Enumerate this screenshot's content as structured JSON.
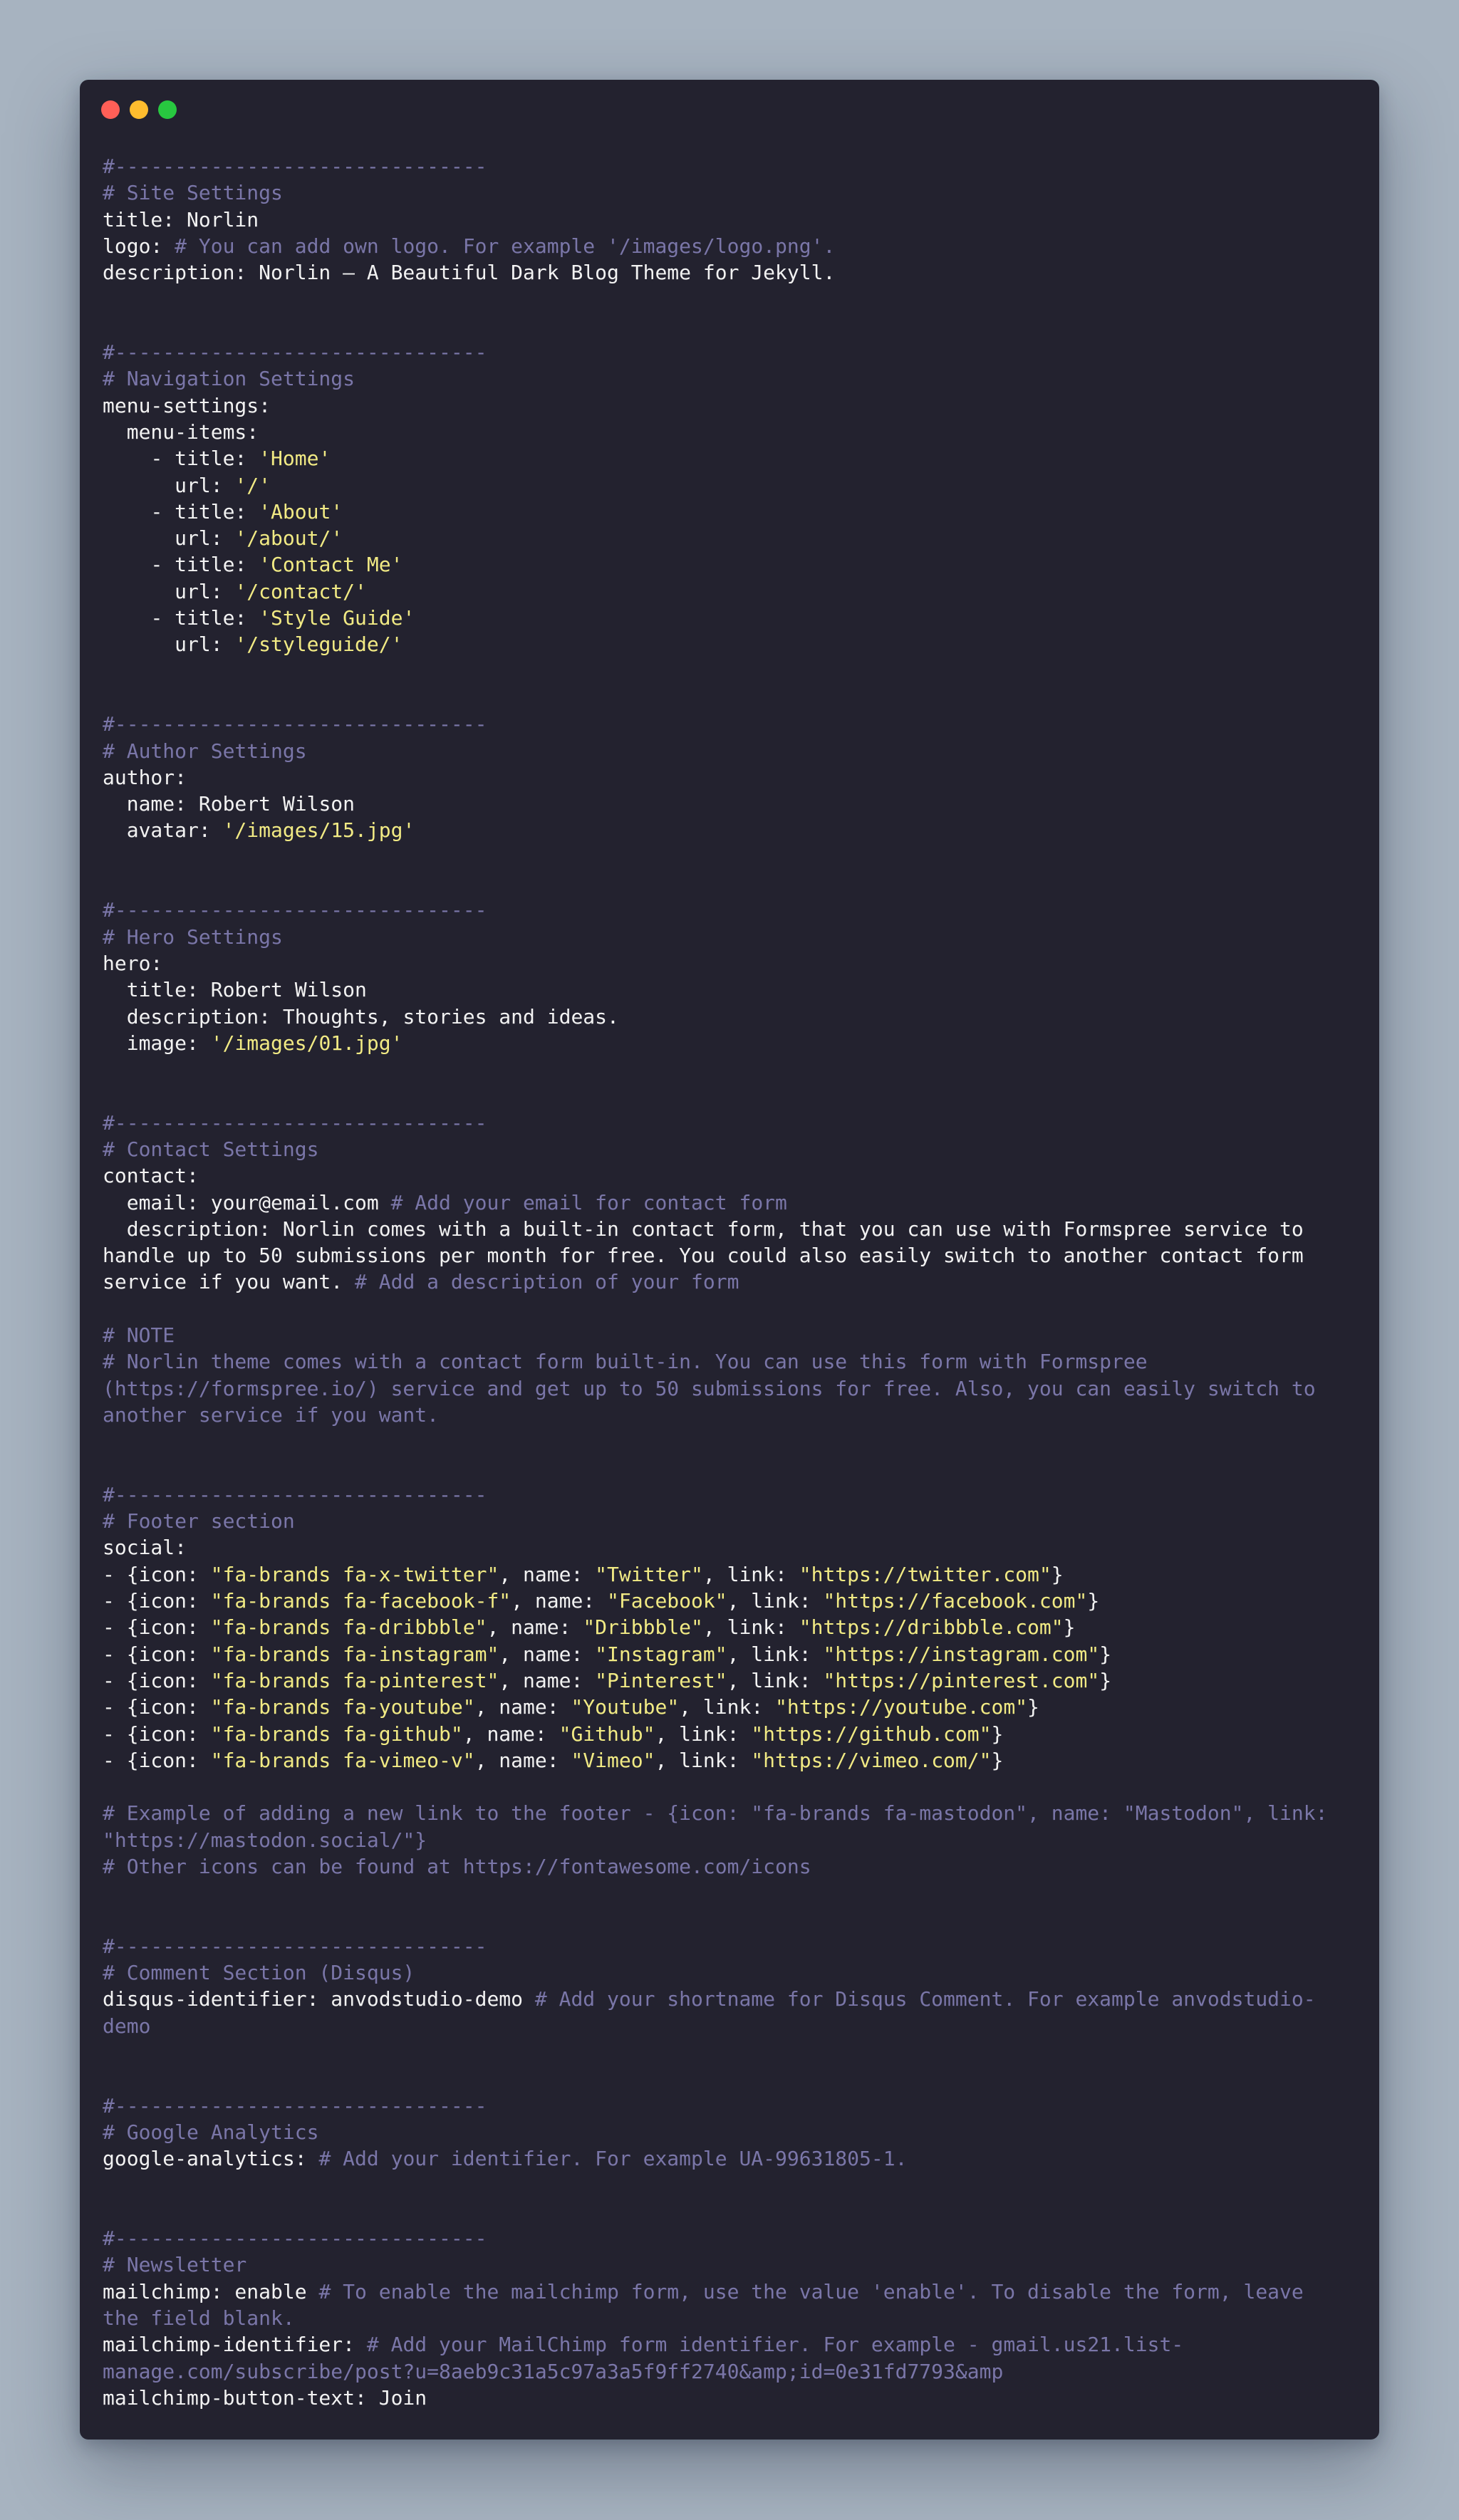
{
  "window": {
    "controls": [
      {
        "name": "close-dot",
        "color": "#ff5f57"
      },
      {
        "name": "minimize-dot",
        "color": "#febc2e"
      },
      {
        "name": "maximize-dot",
        "color": "#28c840"
      }
    ]
  },
  "colors": {
    "background": "#a7b3c0",
    "editor": "#23222f",
    "text": "#f2f2f2",
    "comment": "#7a76a8",
    "string": "#f1ea84"
  },
  "code_lines": [
    [
      [
        "c",
        "#-------------------------------"
      ]
    ],
    [
      [
        "c",
        "# Site Settings"
      ]
    ],
    [
      [
        "k",
        "title: Norlin"
      ]
    ],
    [
      [
        "k",
        "logo: "
      ],
      [
        "c",
        "# You can add own logo. For example '/images/logo.png'."
      ]
    ],
    [
      [
        "k",
        "description: Norlin — A Beautiful Dark Blog Theme for Jekyll."
      ]
    ],
    [],
    [],
    [
      [
        "c",
        "#-------------------------------"
      ]
    ],
    [
      [
        "c",
        "# Navigation Settings"
      ]
    ],
    [
      [
        "k",
        "menu-settings:"
      ]
    ],
    [
      [
        "k",
        "  menu-items:"
      ]
    ],
    [
      [
        "k",
        "    - title: "
      ],
      [
        "s",
        "'Home'"
      ]
    ],
    [
      [
        "k",
        "      url: "
      ],
      [
        "s",
        "'/'"
      ]
    ],
    [
      [
        "k",
        "    - title: "
      ],
      [
        "s",
        "'About'"
      ]
    ],
    [
      [
        "k",
        "      url: "
      ],
      [
        "s",
        "'/about/'"
      ]
    ],
    [
      [
        "k",
        "    - title: "
      ],
      [
        "s",
        "'Contact Me'"
      ]
    ],
    [
      [
        "k",
        "      url: "
      ],
      [
        "s",
        "'/contact/'"
      ]
    ],
    [
      [
        "k",
        "    - title: "
      ],
      [
        "s",
        "'Style Guide'"
      ]
    ],
    [
      [
        "k",
        "      url: "
      ],
      [
        "s",
        "'/styleguide/'"
      ]
    ],
    [],
    [],
    [
      [
        "c",
        "#-------------------------------"
      ]
    ],
    [
      [
        "c",
        "# Author Settings"
      ]
    ],
    [
      [
        "k",
        "author:"
      ]
    ],
    [
      [
        "k",
        "  name: Robert Wilson"
      ]
    ],
    [
      [
        "k",
        "  avatar: "
      ],
      [
        "s",
        "'/images/15.jpg'"
      ]
    ],
    [],
    [],
    [
      [
        "c",
        "#-------------------------------"
      ]
    ],
    [
      [
        "c",
        "# Hero Settings"
      ]
    ],
    [
      [
        "k",
        "hero:"
      ]
    ],
    [
      [
        "k",
        "  title: Robert Wilson"
      ]
    ],
    [
      [
        "k",
        "  description: Thoughts, stories and ideas."
      ]
    ],
    [
      [
        "k",
        "  image: "
      ],
      [
        "s",
        "'/images/01.jpg'"
      ]
    ],
    [],
    [],
    [
      [
        "c",
        "#-------------------------------"
      ]
    ],
    [
      [
        "c",
        "# Contact Settings"
      ]
    ],
    [
      [
        "k",
        "contact:"
      ]
    ],
    [
      [
        "k",
        "  email: your@email.com "
      ],
      [
        "c",
        "# Add your email for contact form"
      ]
    ],
    [
      [
        "k",
        "  description: Norlin comes with a built-in contact form, that you can use with Formspree service to handle up to 50 submissions per month for free. You could also easily switch to another contact form service if you want. "
      ],
      [
        "c",
        "# Add a description of your form"
      ]
    ],
    [],
    [
      [
        "c",
        "# NOTE"
      ]
    ],
    [
      [
        "c",
        "# Norlin theme comes with a contact form built-in. You can use this form with Formspree (https://formspree.io/) service and get up to 50 submissions for free. Also, you can easily switch to another service if you want."
      ]
    ],
    [],
    [],
    [
      [
        "c",
        "#-------------------------------"
      ]
    ],
    [
      [
        "c",
        "# Footer section"
      ]
    ],
    [
      [
        "k",
        "social:"
      ]
    ],
    [
      [
        "k",
        "- {icon: "
      ],
      [
        "s",
        "\"fa-brands fa-x-twitter\""
      ],
      [
        "k",
        ", name: "
      ],
      [
        "s",
        "\"Twitter\""
      ],
      [
        "k",
        ", link: "
      ],
      [
        "s",
        "\"https://twitter.com\""
      ],
      [
        "k",
        "}"
      ]
    ],
    [
      [
        "k",
        "- {icon: "
      ],
      [
        "s",
        "\"fa-brands fa-facebook-f\""
      ],
      [
        "k",
        ", name: "
      ],
      [
        "s",
        "\"Facebook\""
      ],
      [
        "k",
        ", link: "
      ],
      [
        "s",
        "\"https://facebook.com\""
      ],
      [
        "k",
        "}"
      ]
    ],
    [
      [
        "k",
        "- {icon: "
      ],
      [
        "s",
        "\"fa-brands fa-dribbble\""
      ],
      [
        "k",
        ", name: "
      ],
      [
        "s",
        "\"Dribbble\""
      ],
      [
        "k",
        ", link: "
      ],
      [
        "s",
        "\"https://dribbble.com\""
      ],
      [
        "k",
        "}"
      ]
    ],
    [
      [
        "k",
        "- {icon: "
      ],
      [
        "s",
        "\"fa-brands fa-instagram\""
      ],
      [
        "k",
        ", name: "
      ],
      [
        "s",
        "\"Instagram\""
      ],
      [
        "k",
        ", link: "
      ],
      [
        "s",
        "\"https://instagram.com\""
      ],
      [
        "k",
        "}"
      ]
    ],
    [
      [
        "k",
        "- {icon: "
      ],
      [
        "s",
        "\"fa-brands fa-pinterest\""
      ],
      [
        "k",
        ", name: "
      ],
      [
        "s",
        "\"Pinterest\""
      ],
      [
        "k",
        ", link: "
      ],
      [
        "s",
        "\"https://pinterest.com\""
      ],
      [
        "k",
        "}"
      ]
    ],
    [
      [
        "k",
        "- {icon: "
      ],
      [
        "s",
        "\"fa-brands fa-youtube\""
      ],
      [
        "k",
        ", name: "
      ],
      [
        "s",
        "\"Youtube\""
      ],
      [
        "k",
        ", link: "
      ],
      [
        "s",
        "\"https://youtube.com\""
      ],
      [
        "k",
        "}"
      ]
    ],
    [
      [
        "k",
        "- {icon: "
      ],
      [
        "s",
        "\"fa-brands fa-github\""
      ],
      [
        "k",
        ", name: "
      ],
      [
        "s",
        "\"Github\""
      ],
      [
        "k",
        ", link: "
      ],
      [
        "s",
        "\"https://github.com\""
      ],
      [
        "k",
        "}"
      ]
    ],
    [
      [
        "k",
        "- {icon: "
      ],
      [
        "s",
        "\"fa-brands fa-vimeo-v\""
      ],
      [
        "k",
        ", name: "
      ],
      [
        "s",
        "\"Vimeo\""
      ],
      [
        "k",
        ", link: "
      ],
      [
        "s",
        "\"https://vimeo.com/\""
      ],
      [
        "k",
        "}"
      ]
    ],
    [],
    [
      [
        "c",
        "# Example of adding a new link to the footer - {icon: \"fa-brands fa-mastodon\", name: \"Mastodon\", link: \"https://mastodon.social/\"}"
      ]
    ],
    [
      [
        "c",
        "# Other icons can be found at https://fontawesome.com/icons"
      ]
    ],
    [],
    [],
    [
      [
        "c",
        "#-------------------------------"
      ]
    ],
    [
      [
        "c",
        "# Comment Section (Disqus)"
      ]
    ],
    [
      [
        "k",
        "disqus-identifier: anvodstudio-demo "
      ],
      [
        "c",
        "# Add your shortname for Disqus Comment. For example anvodstudio-demo"
      ]
    ],
    [],
    [],
    [
      [
        "c",
        "#-------------------------------"
      ]
    ],
    [
      [
        "c",
        "# Google Analytics"
      ]
    ],
    [
      [
        "k",
        "google-analytics: "
      ],
      [
        "c",
        "# Add your identifier. For example UA-99631805-1."
      ]
    ],
    [],
    [],
    [
      [
        "c",
        "#-------------------------------"
      ]
    ],
    [
      [
        "c",
        "# Newsletter"
      ]
    ],
    [
      [
        "k",
        "mailchimp: enable "
      ],
      [
        "c",
        "# To enable the mailchimp form, use the value 'enable'. To disable the form, leave the field blank."
      ]
    ],
    [
      [
        "k",
        "mailchimp-identifier: "
      ],
      [
        "c",
        "# Add your MailChimp form identifier. For example - gmail.us21.list-manage.com/subscribe/post?u=8aeb9c31a5c97a3a5f9ff2740&amp;id=0e31fd7793&amp"
      ]
    ],
    [
      [
        "k",
        "mailchimp-button-text: Join"
      ]
    ]
  ]
}
